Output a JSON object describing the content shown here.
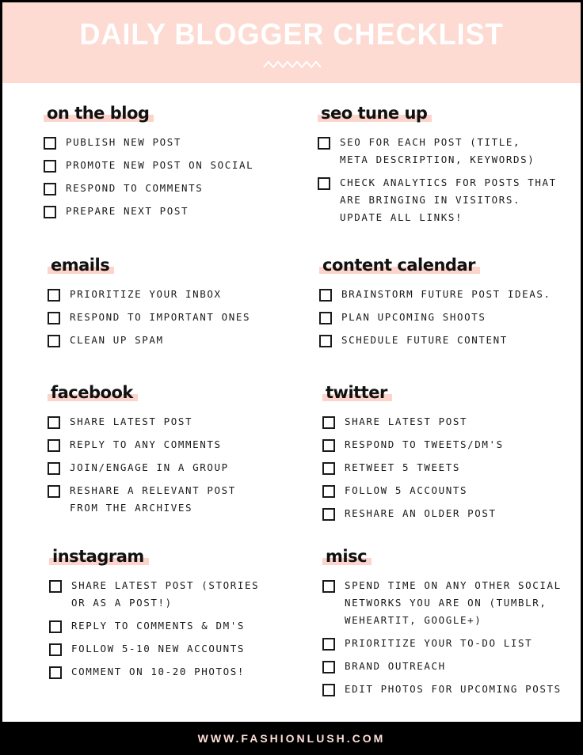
{
  "header": {
    "title": "DAILY BLOGGER CHECKLIST",
    "ornament": "zigzag-divider",
    "background_color": "#fddad2",
    "highlight_color": "#fcd4cb"
  },
  "sections": [
    {
      "title": "on the blog",
      "items": [
        "PUBLISH NEW POST",
        "PROMOTE NEW POST ON SOCIAL",
        "RESPOND TO COMMENTS",
        "PREPARE NEXT POST"
      ]
    },
    {
      "title": "seo tune up",
      "items": [
        "SEO FOR EACH POST (TITLE,\nMETA DESCRIPTION, KEYWORDS)",
        "CHECK ANALYTICS FOR POSTS THAT\nARE BRINGING IN VISITORS.\nUPDATE ALL LINKS!"
      ]
    },
    {
      "title": "emails",
      "items": [
        "PRIORITIZE YOUR INBOX",
        "RESPOND TO IMPORTANT ONES",
        "CLEAN UP SPAM"
      ]
    },
    {
      "title": "content calendar",
      "items": [
        "BRAINSTORM FUTURE POST IDEAS.",
        "PLAN UPCOMING SHOOTS",
        "SCHEDULE FUTURE CONTENT"
      ]
    },
    {
      "title": "facebook",
      "items": [
        "SHARE LATEST POST",
        "REPLY TO ANY COMMENTS",
        "JOIN/ENGAGE IN A GROUP",
        "RESHARE A RELEVANT POST\nFROM THE ARCHIVES"
      ]
    },
    {
      "title": "twitter",
      "items": [
        "SHARE LATEST POST",
        "RESPOND TO TWEETS/DM'S",
        "RETWEET 5 TWEETS",
        "FOLLOW 5 ACCOUNTS",
        "RESHARE AN OLDER POST"
      ]
    },
    {
      "title": "instagram",
      "items": [
        "SHARE LATEST POST (STORIES\nOR AS A POST!)",
        "REPLY TO COMMENTS & DM'S",
        "FOLLOW 5-10 NEW ACCOUNTS",
        "COMMENT ON 10-20 PHOTOS!"
      ]
    },
    {
      "title": "misc",
      "items": [
        "SPEND TIME ON ANY OTHER SOCIAL\nNETWORKS YOU ARE ON (TUMBLR,\nWEHEARTIT, GOOGLE+)",
        "PRIORITIZE YOUR TO-DO LIST",
        "BRAND OUTREACH",
        "EDIT PHOTOS FOR UPCOMING POSTS"
      ]
    }
  ],
  "footer": {
    "url": "WWW.FASHIONLUSH.COM"
  }
}
